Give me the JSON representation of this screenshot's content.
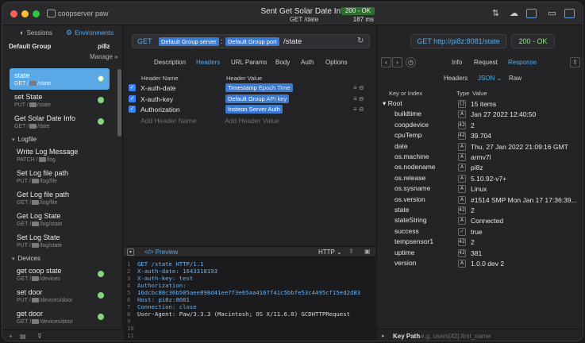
{
  "titlebar": {
    "app_title": "coopserver paw",
    "request_title": "Sent Get Solar Date Info",
    "request_path": "GET /date",
    "status": "200 - OK",
    "time": "187 ms"
  },
  "sidebar": {
    "tab_sessions": "Sessions",
    "tab_environments": "Environments",
    "env_label": "Default Group",
    "env_value": "pi8z",
    "manage": "Manage »",
    "items": [
      {
        "name": "state",
        "method": "GET /",
        "path": "/state",
        "selected": true
      },
      {
        "name": "set State",
        "method": "PUT /",
        "path": "/state"
      },
      {
        "name": "Get Solar Date Info",
        "method": "GET /",
        "path": "/date"
      }
    ],
    "group_logfile": "Logfile",
    "logfile_items": [
      {
        "name": "Write Log Message",
        "method": "PATCH /",
        "path": "/log"
      },
      {
        "name": "Set Log file path",
        "method": "PUT /",
        "path": "/log/file"
      },
      {
        "name": "Get Log file path",
        "method": "GET /",
        "path": "/log/file"
      },
      {
        "name": "Get Log State",
        "method": "GET /",
        "path": "/log/state"
      },
      {
        "name": "Set Log State",
        "method": "PUT /",
        "path": "/log/state"
      }
    ],
    "group_devices": "Devices",
    "device_items": [
      {
        "name": "get coop state",
        "method": "GET /",
        "path": "/devices"
      },
      {
        "name": "set door",
        "method": "PUT /",
        "path": "/devices/door"
      },
      {
        "name": "get door",
        "method": "GET /",
        "path": "/devices/door"
      }
    ]
  },
  "request": {
    "method": "GET",
    "token_group": "Default Group",
    "token_server": "server",
    "token_group2": "Default Group",
    "token_port": "port",
    "path": "/state",
    "tabs": [
      "Description",
      "Headers",
      "URL Params",
      "Body",
      "Auth",
      "Options"
    ],
    "active_tab": "Headers",
    "header_col_name": "Header Name",
    "header_col_value": "Header Value",
    "headers": [
      {
        "name": "X-auth-date",
        "value": "Timestamp",
        "value_sub": "Epoch Time"
      },
      {
        "name": "X-auth-key",
        "value": "Default Group",
        "value_sub": "API key"
      },
      {
        "name": "Authorization",
        "value": "Insteon Server Auth",
        "value_sub": ""
      }
    ],
    "add_name_placeholder": "Add Header Name",
    "add_value_placeholder": "Add Header Value",
    "preview_label": "</>  Preview",
    "http_label": "HTTP ⌄"
  },
  "code_lines": [
    "GET /state HTTP/1.1",
    "X-auth-date: 1643318193",
    "X-auth-key: test",
    "Authorization:",
    "16dcbc88c36b505aee898d41ee7f3e65aa4167f41c5bbfe53c4495cf15ed2d83",
    "Host: pi8z:8081",
    "Connection: close",
    "User-Agent: Paw/3.3.3 (Macintosh; OS X/11.6.0) GCDHTTPRequest",
    "",
    "",
    "",
    ""
  ],
  "response": {
    "url": "GET http://pi8z:8081/state",
    "status": "200 - OK",
    "tabs": [
      "Info",
      "Request",
      "Response"
    ],
    "active_tab": "Response",
    "subtabs": [
      "Headers",
      "JSON ⌄",
      "Raw"
    ],
    "active_subtab": "JSON ⌄",
    "col_key": "Key or Index",
    "col_type": "Type",
    "col_value": "Value",
    "rows": [
      {
        "key": "Root",
        "type": "{}",
        "value": "15 items",
        "root": true
      },
      {
        "key": "buildtime",
        "type": "A",
        "value": "Jan 27 2022 12:40:50"
      },
      {
        "key": "coopdevice",
        "type": "42",
        "value": "2"
      },
      {
        "key": "cpuTemp",
        "type": "42",
        "value": "39.704"
      },
      {
        "key": "date",
        "type": "A",
        "value": "Thu, 27 Jan 2022 21:09:16 GMT"
      },
      {
        "key": "os.machine",
        "type": "A",
        "value": "armv7l"
      },
      {
        "key": "os.nodename",
        "type": "A",
        "value": "pi8z"
      },
      {
        "key": "os.release",
        "type": "A",
        "value": "5.10.92-v7+"
      },
      {
        "key": "os.sysname",
        "type": "A",
        "value": "Linux"
      },
      {
        "key": "os.version",
        "type": "A",
        "value": "#1514 SMP Mon Jan 17 17:36:39..."
      },
      {
        "key": "state",
        "type": "42",
        "value": "2"
      },
      {
        "key": "stateString",
        "type": "A",
        "value": "Connected"
      },
      {
        "key": "success",
        "type": "✓",
        "value": "true"
      },
      {
        "key": "tempsensor1",
        "type": "42",
        "value": "2"
      },
      {
        "key": "uptime",
        "type": "42",
        "value": "381"
      },
      {
        "key": "version",
        "type": "A",
        "value": "1.0.0 dev 2"
      }
    ],
    "keypath_label": "Key Path",
    "keypath_placeholder": "e.g. users[42].first_name"
  }
}
